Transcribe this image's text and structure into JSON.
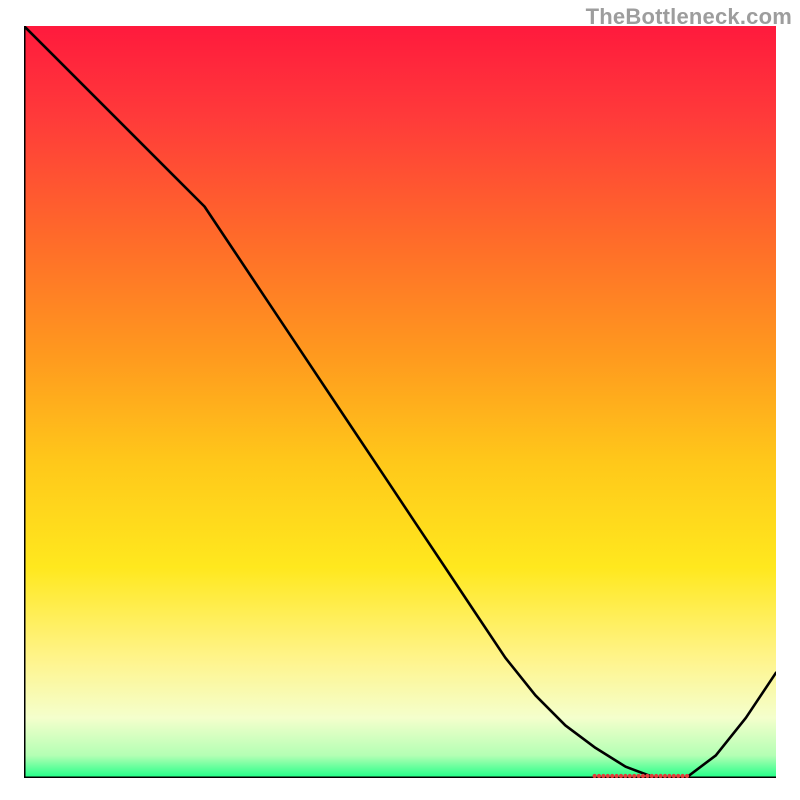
{
  "watermark": "TheBottleneck.com",
  "chart_data": {
    "type": "line",
    "title": "",
    "xlabel": "",
    "ylabel": "",
    "x": [
      0.0,
      0.04,
      0.08,
      0.12,
      0.16,
      0.2,
      0.24,
      0.28,
      0.32,
      0.36,
      0.4,
      0.44,
      0.48,
      0.52,
      0.56,
      0.6,
      0.64,
      0.68,
      0.72,
      0.76,
      0.8,
      0.84,
      0.88,
      0.92,
      0.96,
      1.0
    ],
    "values": [
      1.0,
      0.96,
      0.92,
      0.88,
      0.84,
      0.8,
      0.76,
      0.7,
      0.64,
      0.58,
      0.52,
      0.46,
      0.4,
      0.34,
      0.28,
      0.22,
      0.16,
      0.11,
      0.07,
      0.04,
      0.015,
      0.0,
      0.0,
      0.03,
      0.08,
      0.14
    ],
    "xlim": [
      0,
      1
    ],
    "ylim": [
      0,
      1
    ],
    "point_marker": {
      "x": 0.82,
      "y": 0.0
    },
    "background_gradient": {
      "stops": [
        {
          "offset": 0.0,
          "color": "#ff1a3d"
        },
        {
          "offset": 0.12,
          "color": "#ff3a3a"
        },
        {
          "offset": 0.28,
          "color": "#ff6a2a"
        },
        {
          "offset": 0.44,
          "color": "#ff9a1e"
        },
        {
          "offset": 0.58,
          "color": "#ffc81a"
        },
        {
          "offset": 0.72,
          "color": "#ffe81e"
        },
        {
          "offset": 0.84,
          "color": "#fff48a"
        },
        {
          "offset": 0.92,
          "color": "#f4ffcc"
        },
        {
          "offset": 0.97,
          "color": "#b4ffb4"
        },
        {
          "offset": 1.0,
          "color": "#1eff87"
        }
      ]
    }
  }
}
